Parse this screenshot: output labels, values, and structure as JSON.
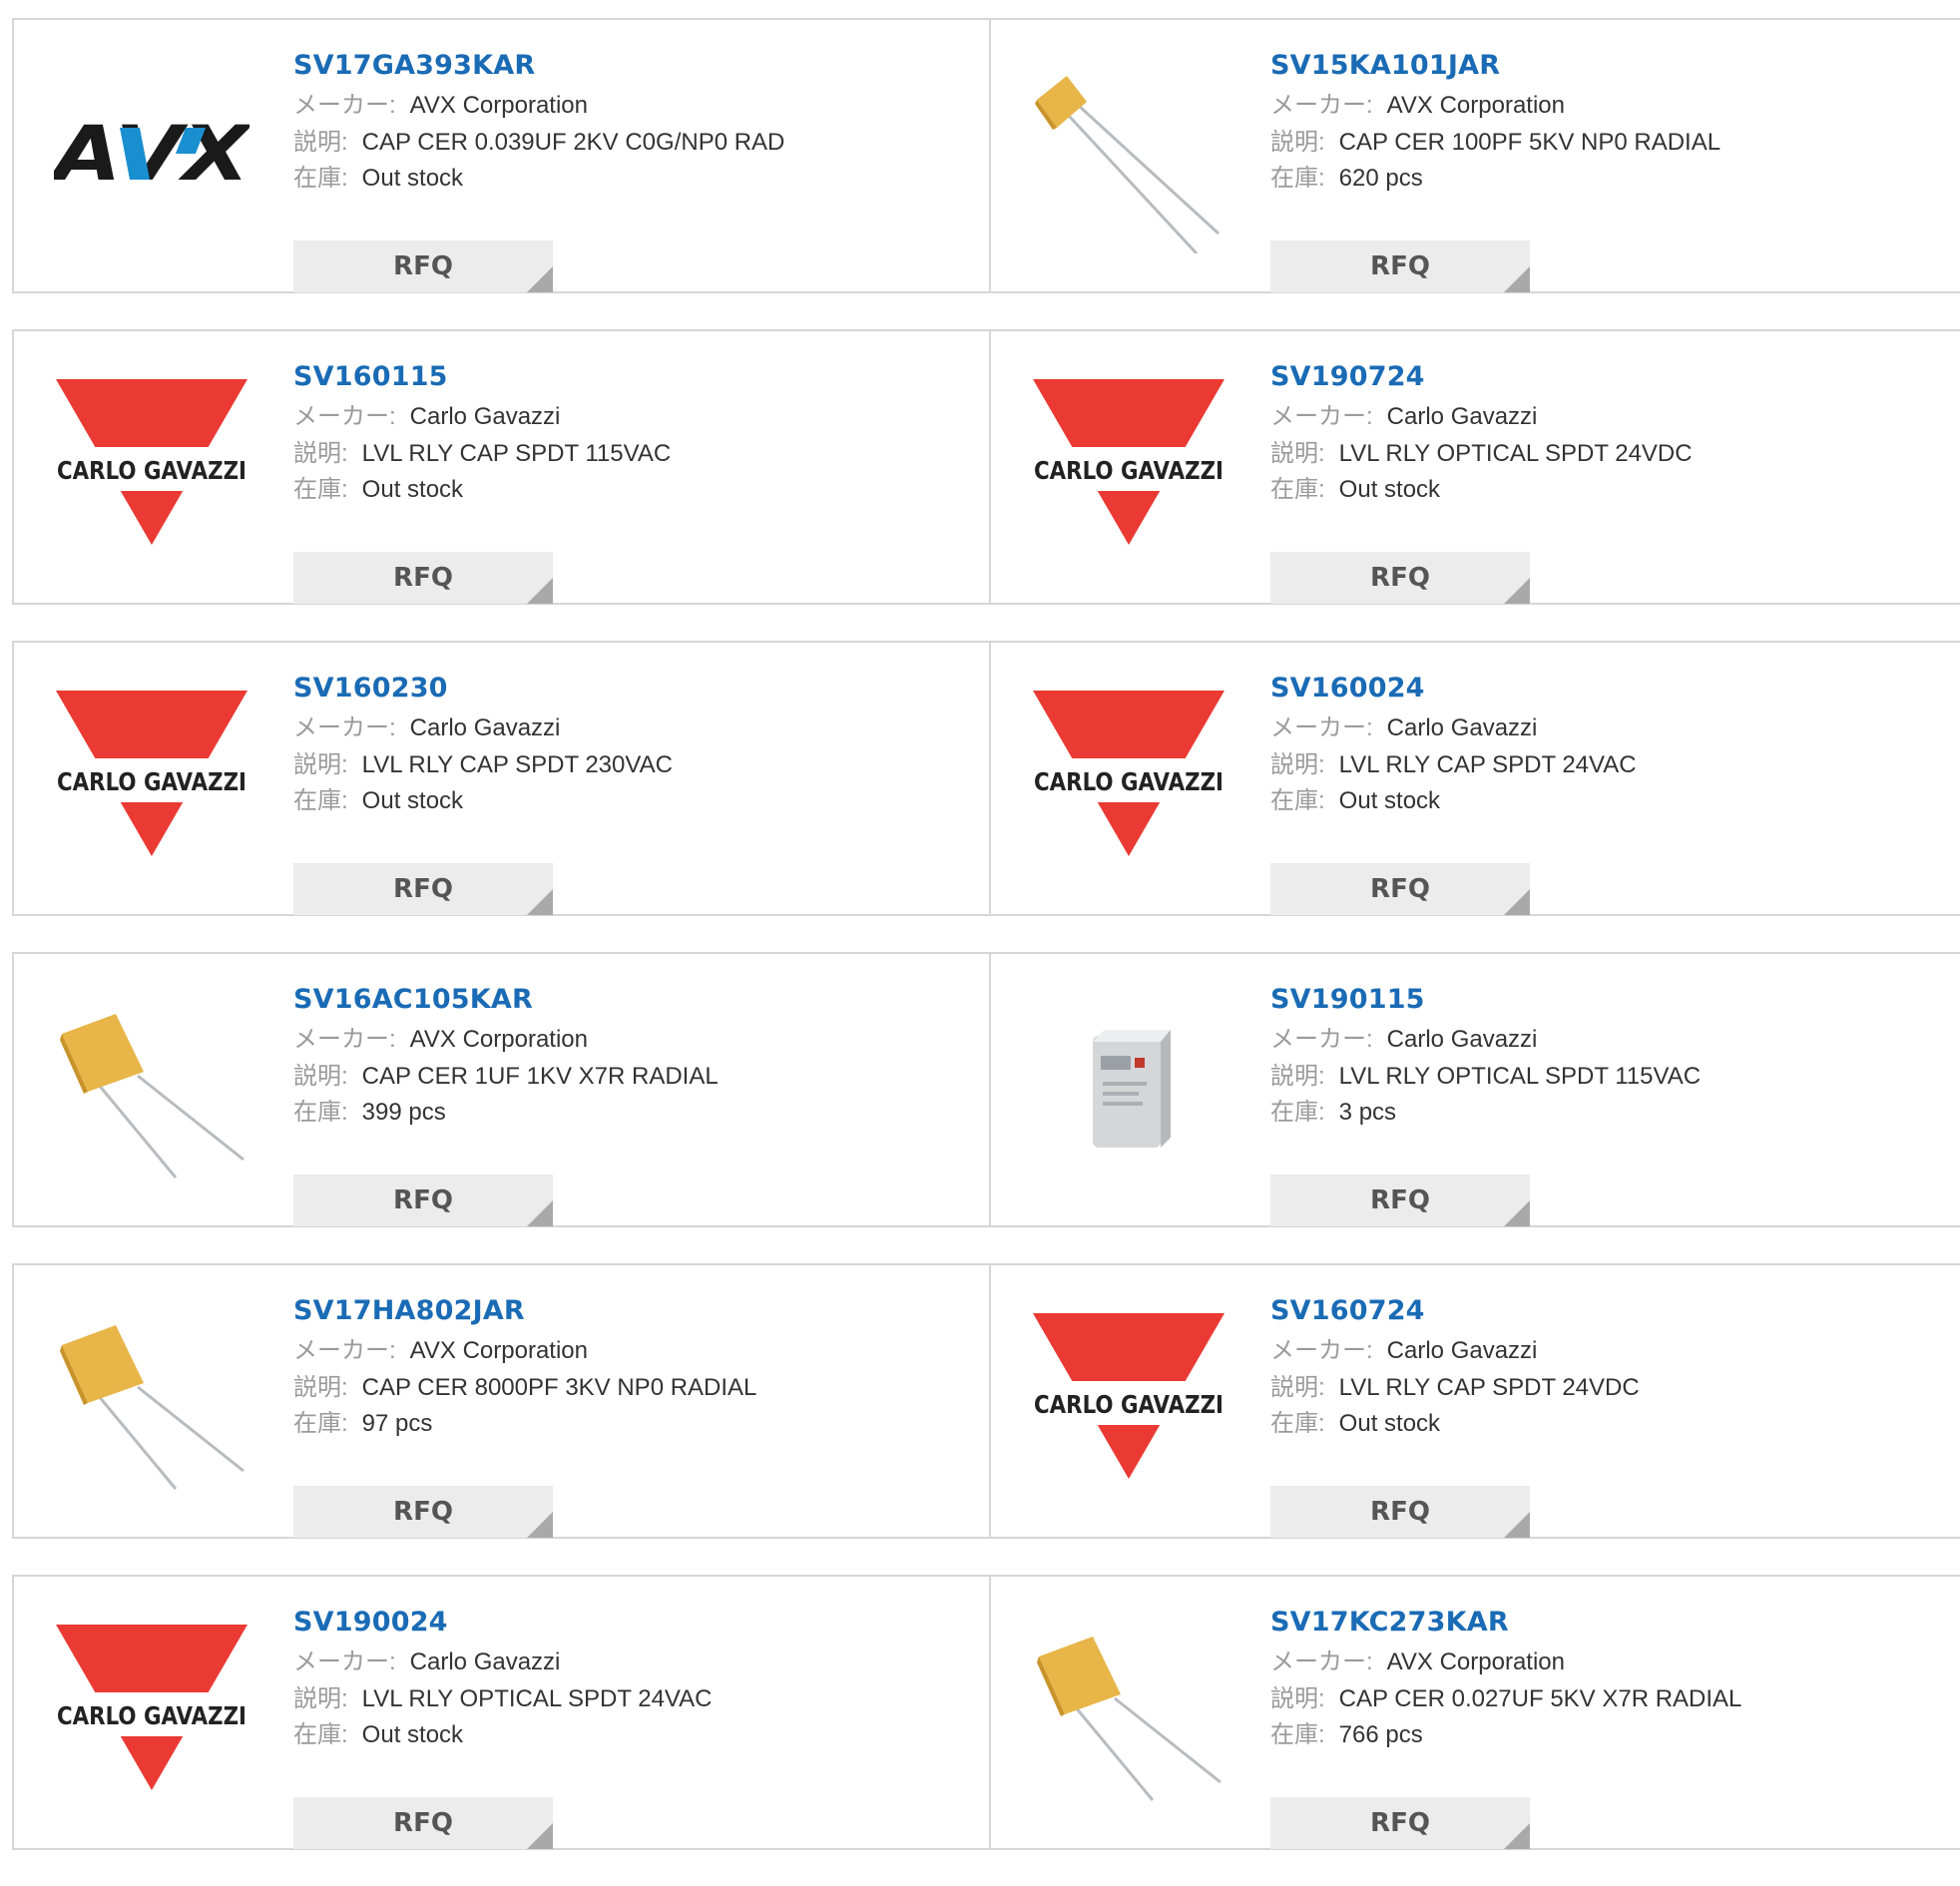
{
  "labels": {
    "maker": "メーカー:",
    "description": "説明:",
    "stock": "在庫:",
    "rfq": "RFQ"
  },
  "logo_text": {
    "carlo_gavazzi": "CARLO GAVAZZI",
    "avx": "AVX"
  },
  "colors": {
    "link": "#1a6bb5",
    "rfq_bg": "#ececec",
    "carlo_gavazzi_red": "#ea3a33",
    "capacitor_yellow": "#e8b548"
  },
  "products": [
    {
      "part": "SV17GA393KAR",
      "maker": "AVX Corporation",
      "description": "CAP CER 0.039UF 2KV C0G/NP0 RAD",
      "stock": "Out stock",
      "image": "avx-logo"
    },
    {
      "part": "SV15KA101JAR",
      "maker": "AVX Corporation",
      "description": "CAP CER 100PF 5KV NP0 RADIAL",
      "stock": "620 pcs",
      "image": "capacitor-small"
    },
    {
      "part": "SV160115",
      "maker": "Carlo Gavazzi",
      "description": "LVL RLY CAP SPDT 115VAC",
      "stock": "Out stock",
      "image": "carlo-gavazzi-logo"
    },
    {
      "part": "SV190724",
      "maker": "Carlo Gavazzi",
      "description": "LVL RLY OPTICAL SPDT 24VDC",
      "stock": "Out stock",
      "image": "carlo-gavazzi-logo"
    },
    {
      "part": "SV160230",
      "maker": "Carlo Gavazzi",
      "description": "LVL RLY CAP SPDT 230VAC",
      "stock": "Out stock",
      "image": "carlo-gavazzi-logo"
    },
    {
      "part": "SV160024",
      "maker": "Carlo Gavazzi",
      "description": "LVL RLY CAP SPDT 24VAC",
      "stock": "Out stock",
      "image": "carlo-gavazzi-logo"
    },
    {
      "part": "SV16AC105KAR",
      "maker": "AVX Corporation",
      "description": "CAP CER 1UF 1KV X7R RADIAL",
      "stock": "399 pcs",
      "image": "capacitor-large"
    },
    {
      "part": "SV190115",
      "maker": "Carlo Gavazzi",
      "description": "LVL RLY OPTICAL SPDT 115VAC",
      "stock": "3 pcs",
      "image": "relay-module"
    },
    {
      "part": "SV17HA802JAR",
      "maker": "AVX Corporation",
      "description": "CAP CER 8000PF 3KV NP0 RADIAL",
      "stock": "97 pcs",
      "image": "capacitor-large"
    },
    {
      "part": "SV160724",
      "maker": "Carlo Gavazzi",
      "description": "LVL RLY CAP SPDT 24VDC",
      "stock": "Out stock",
      "image": "carlo-gavazzi-logo"
    },
    {
      "part": "SV190024",
      "maker": "Carlo Gavazzi",
      "description": "LVL RLY OPTICAL SPDT 24VAC",
      "stock": "Out stock",
      "image": "carlo-gavazzi-logo"
    },
    {
      "part": "SV17KC273KAR",
      "maker": "AVX Corporation",
      "description": "CAP CER 0.027UF 5KV X7R RADIAL",
      "stock": "766 pcs",
      "image": "capacitor-large"
    }
  ]
}
